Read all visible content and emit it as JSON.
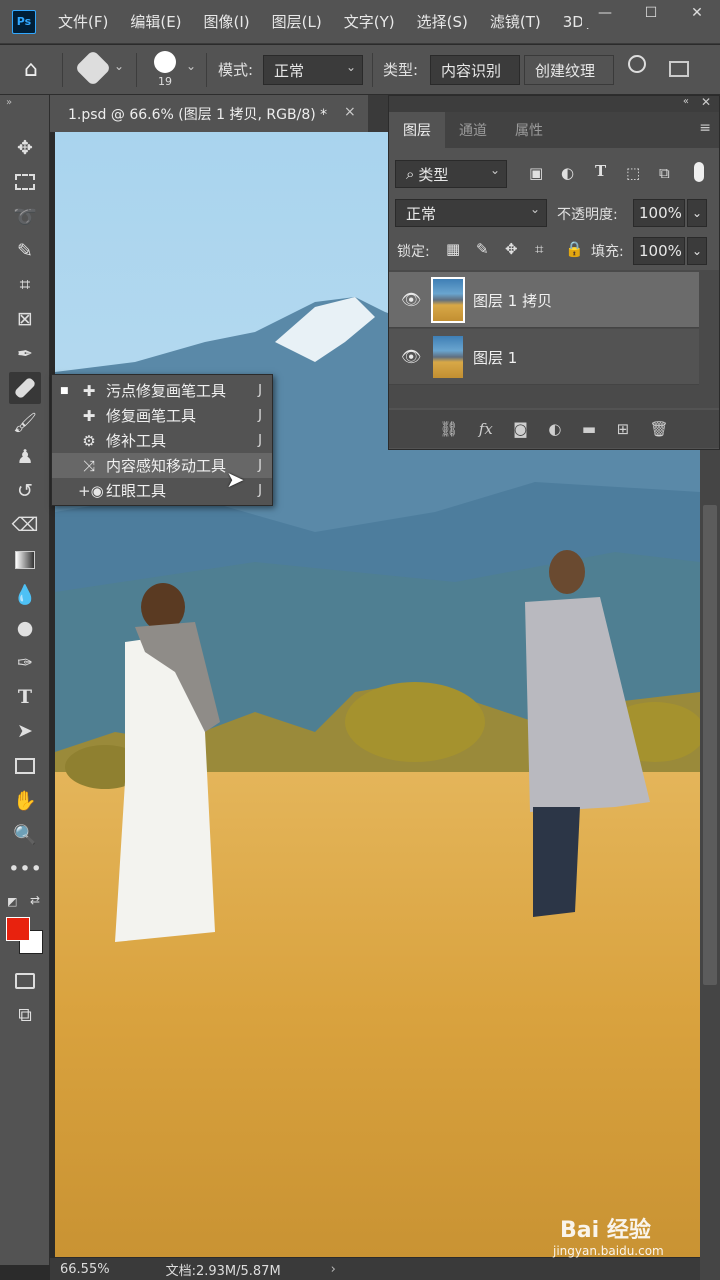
{
  "app": {
    "logo": "Ps"
  },
  "menubar": {
    "items": [
      "文件(F)",
      "编辑(E)",
      "图像(I)",
      "图层(L)",
      "文字(Y)",
      "选择(S)",
      "滤镜(T)",
      "3D("
    ]
  },
  "options": {
    "brush_size": "19",
    "mode_label": "模式:",
    "mode_value": "正常",
    "type_label": "类型:",
    "type_content_aware": "内容识别",
    "type_texture": "创建纹理"
  },
  "document": {
    "tab_title": "1.psd @ 66.6% (图层 1 拷贝, RGB/8) *",
    "close": "×"
  },
  "status": {
    "zoom": "66.55%",
    "doc": "文档:2.93M/5.87M"
  },
  "flyout": {
    "items": [
      {
        "label": "污点修复画笔工具",
        "key": "J",
        "icon": "spot-healing-brush-icon",
        "active": true
      },
      {
        "label": "修复画笔工具",
        "key": "J",
        "icon": "healing-brush-icon",
        "active": false
      },
      {
        "label": "修补工具",
        "key": "J",
        "icon": "patch-icon",
        "active": false
      },
      {
        "label": "内容感知移动工具",
        "key": "J",
        "icon": "content-aware-move-icon",
        "active": false
      },
      {
        "label": "红眼工具",
        "key": "J",
        "icon": "red-eye-icon",
        "active": false
      }
    ]
  },
  "layers_panel": {
    "tabs": [
      "图层",
      "通道",
      "属性"
    ],
    "filter_label": "类型",
    "blend_mode": "正常",
    "opacity_label": "不透明度:",
    "opacity_value": "100%",
    "lock_label": "锁定:",
    "fill_label": "填充:",
    "fill_value": "100%",
    "layers": [
      {
        "name": "图层 1 拷贝",
        "selected": true
      },
      {
        "name": "图层 1",
        "selected": false
      }
    ]
  },
  "colors": {
    "foreground": "#e8220e",
    "background": "#ffffff",
    "ui": "#535353"
  },
  "watermark": {
    "brand": "Bai 经验",
    "url": "jingyan.baidu.com"
  }
}
